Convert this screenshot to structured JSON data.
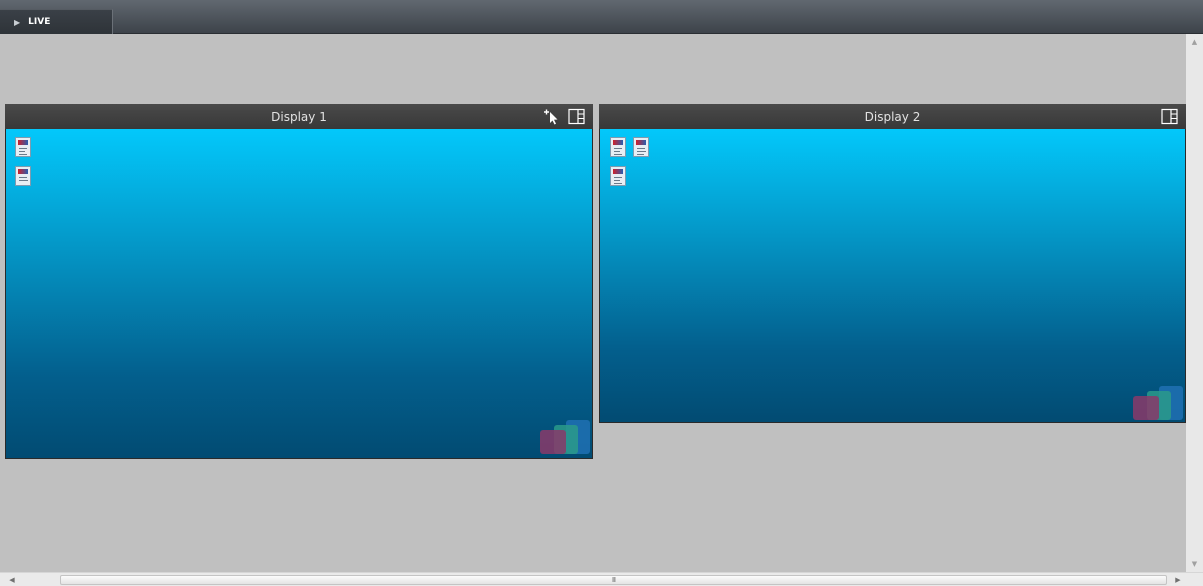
{
  "toolbar": {
    "tab_label": "LIVE",
    "play_glyph": "▶"
  },
  "displays": [
    {
      "title": "Display 1",
      "icons": [
        "desktop-shortcut",
        "desktop-shortcut"
      ],
      "tools": [
        "add-pointer-icon",
        "layout-icon"
      ]
    },
    {
      "title": "Display 2",
      "icons": [
        "desktop-shortcut",
        "desktop-shortcut",
        "desktop-shortcut"
      ],
      "tools": [
        "layout-icon"
      ]
    }
  ],
  "scrollbars": {
    "up_glyph": "▲",
    "down_glyph": "▼",
    "left_glyph": "◀",
    "right_glyph": "▶",
    "grip_glyph": "III"
  },
  "colors": {
    "desktop_top": "#03c8fb",
    "desktop_bottom": "#024b72",
    "header_bg": "#3c3c3c",
    "workspace_bg": "#c0c0c0"
  }
}
